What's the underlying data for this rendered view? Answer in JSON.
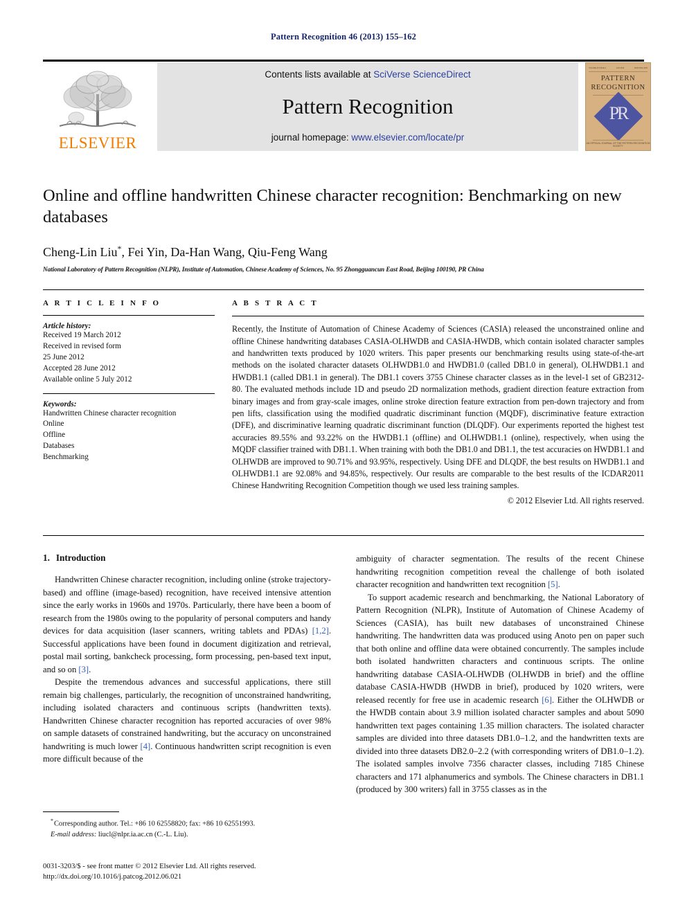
{
  "running_head": "Pattern Recognition 46 (2013) 155–162",
  "masthead": {
    "publisher_name": "ELSEVIER",
    "contents_prefix": "Contents lists available at ",
    "contents_link": "SciVerse ScienceDirect",
    "journal_name": "Pattern Recognition",
    "homepage_prefix": "journal homepage: ",
    "homepage_link": "www.elsevier.com/locate/pr",
    "cover": {
      "line1": "PATTERN",
      "line2": "RECOGNITION",
      "monogram": "PR",
      "top_left": "VOLUME 46  ISSUE 1",
      "top_mid": "JAN 2013",
      "top_right": "ISSN 0031-3203",
      "bottom": "AN OFFICIAL JOURNAL OF THE PATTERN RECOGNITION SOCIETY"
    }
  },
  "title": "Online and offline handwritten Chinese character recognition: Benchmarking on new databases",
  "authors": "Cheng-Lin Liu",
  "authors_rest": ", Fei Yin, Da-Han Wang, Qiu-Feng Wang",
  "affiliation": "National Laboratory of Pattern Recognition (NLPR), Institute of Automation, Chinese Academy of Sciences, No. 95 Zhongguancun East Road, Beijing 100190, PR China",
  "article_info": {
    "heading": "A R T I C L E   I N F O",
    "history_label": "Article history:",
    "history_lines": [
      "Received 19 March 2012",
      "Received in revised form",
      "25 June 2012",
      "Accepted 28 June 2012",
      "Available online 5 July 2012"
    ],
    "keywords_label": "Keywords:",
    "keywords": [
      "Handwritten Chinese character recognition",
      "Online",
      "Offline",
      "Databases",
      "Benchmarking"
    ]
  },
  "abstract": {
    "heading": "A B S T R A C T",
    "text": "Recently, the Institute of Automation of Chinese Academy of Sciences (CASIA) released the unconstrained online and offline Chinese handwriting databases CASIA-OLHWDB and CASIA-HWDB, which contain isolated character samples and handwritten texts produced by 1020 writers. This paper presents our benchmarking results using state-of-the-art methods on the isolated character datasets OLHWDB1.0 and HWDB1.0 (called DB1.0 in general), OLHWDB1.1 and HWDB1.1 (called DB1.1 in general). The DB1.1 covers 3755 Chinese character classes as in the level-1 set of GB2312-80. The evaluated methods include 1D and pseudo 2D normalization methods, gradient direction feature extraction from binary images and from gray-scale images, online stroke direction feature extraction from pen-down trajectory and from pen lifts, classification using the modified quadratic discriminant function (MQDF), discriminative feature extraction (DFE), and discriminative learning quadratic discriminant function (DLQDF). Our experiments reported the highest test accuracies 89.55% and 93.22% on the HWDB1.1 (offline) and OLHWDB1.1 (online), respectively, when using the MQDF classifier trained with DB1.1. When training with both the DB1.0 and DB1.1, the test accuracies on HWDB1.1 and OLHWDB are improved to 90.71% and 93.95%, respectively. Using DFE and DLQDF, the best results on HWDB1.1 and OLHWDB1.1 are 92.08% and 94.85%, respectively. Our results are comparable to the best results of the ICDAR2011 Chinese Handwriting Recognition Competition though we used less training samples.",
    "copyright": "© 2012 Elsevier Ltd. All rights reserved."
  },
  "section": {
    "number": "1.",
    "title": "Introduction"
  },
  "body": {
    "left": [
      {
        "parts": [
          {
            "t": "Handwritten Chinese character recognition, including online (stroke trajectory-based) and offline (image-based) recognition, have received intensive attention since the early works in 1960s and 1970s. Particularly, there have been a boom of research from the 1980s owing to the popularity of personal computers and handy devices for data acquisition (laser scanners, writing tablets and PDAs) ",
            "c": false
          },
          {
            "t": "[1,2]",
            "c": true
          },
          {
            "t": ". Successful applications have been found in document digitization and retrieval, postal mail sorting, bankcheck processing, form processing, pen-based text input, and so on ",
            "c": false
          },
          {
            "t": "[3]",
            "c": true
          },
          {
            "t": ".",
            "c": false
          }
        ]
      },
      {
        "parts": [
          {
            "t": "Despite the tremendous advances and successful applications, there still remain big challenges, particularly, the recognition of unconstrained handwriting, including isolated characters and continuous scripts (handwritten texts). Handwritten Chinese character recognition has reported accuracies of over 98% on sample datasets of constrained handwriting, but the accuracy on unconstrained handwriting is much lower ",
            "c": false
          },
          {
            "t": "[4]",
            "c": true
          },
          {
            "t": ". Continuous handwritten script recognition is even more difficult because of the",
            "c": false
          }
        ]
      }
    ],
    "right": [
      {
        "parts": [
          {
            "t": "ambiguity of character segmentation. The results of the recent Chinese handwriting recognition competition reveal the challenge of both isolated character recognition and handwritten text recognition ",
            "c": false
          },
          {
            "t": "[5]",
            "c": true
          },
          {
            "t": ".",
            "c": false
          }
        ],
        "no_indent": true
      },
      {
        "parts": [
          {
            "t": "To support academic research and benchmarking, the National Laboratory of Pattern Recognition (NLPR), Institute of Automation of Chinese Academy of Sciences (CASIA), has built new databases of unconstrained Chinese handwriting. The handwritten data was produced using Anoto pen on paper such that both online and offline data were obtained concurrently. The samples include both isolated handwritten characters and continuous scripts. The online handwriting database CASIA-OLHWDB (OLHWDB in brief) and the offline database CASIA-HWDB (HWDB in brief), produced by 1020 writers, were released recently for free use in academic research ",
            "c": false
          },
          {
            "t": "[6]",
            "c": true
          },
          {
            "t": ". Either the OLHWDB or the HWDB contain about 3.9 million isolated character samples and about 5090 handwritten text pages containing 1.35 million characters. The isolated character samples are divided into three datasets DB1.0–1.2, and the handwritten texts are divided into three datasets DB2.0–2.2 (with corresponding writers of DB1.0–1.2). The isolated samples involve 7356 character classes, including 7185 Chinese characters and 171 alphanumerics and symbols. The Chinese characters in DB1.1 (produced by 300 writers) fall in 3755 classes as in the",
            "c": false
          }
        ]
      }
    ]
  },
  "footnotes": {
    "corresponding": "Corresponding author. Tel.: +86 10 62558820; fax: +86 10 62551993.",
    "email_label": "E-mail address:",
    "email": "liucl@nlpr.ia.ac.cn (C.-L. Liu).",
    "imprint_line1": "0031-3203/$ - see front matter © 2012 Elsevier Ltd. All rights reserved.",
    "imprint_line2": "http://dx.doi.org/10.1016/j.patcog.2012.06.021"
  },
  "colors": {
    "running_head": "#16246b",
    "link": "#2b3f9e",
    "citation": "#2f5fc0",
    "elsevier_orange": "#f07d00",
    "band_gray": "#e3e3e3",
    "cover_tan": "#d7b182",
    "cover_blue": "#4e55a0"
  }
}
